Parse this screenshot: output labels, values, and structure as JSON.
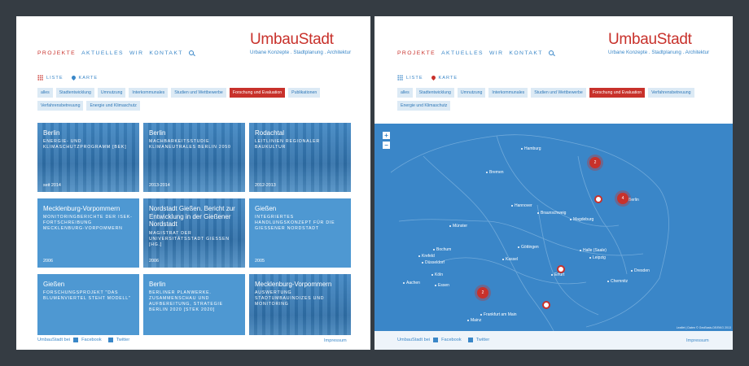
{
  "brand": {
    "logo": "UmbauStadt",
    "tagline": "Urbane Konzepte . Stadtplanung . Architektur",
    "accent": "#c8312b",
    "blue": "#3a87c8"
  },
  "nav": {
    "items": [
      "PROJEKTE",
      "AKTUELLES",
      "WIR",
      "KONTAKT"
    ]
  },
  "views": {
    "list": "LISTE",
    "map": "KARTE"
  },
  "filters": [
    "alles",
    "Stadtentwicklung",
    "Umnutzung",
    "Interkommunales",
    "Studien und Wettbewerbe",
    "Forschung und Evaluation",
    "Publikationen",
    "Verfahrensbetreuung",
    "Energie und Klimaschutz"
  ],
  "tiles": [
    {
      "title": "Berlin",
      "desc": "ENERGIE- UND KLIMASCHUTZPROGRAMM [BEK]",
      "year": "seit 2014"
    },
    {
      "title": "Berlin",
      "desc": "MACHBARKEITSSTUDIE KLIMANEUTRALES BERLIN 2050",
      "year": "2013-2014"
    },
    {
      "title": "Rodachtal",
      "desc": "LEITLINIEN REGIONALER BAUKULTUR",
      "year": "2012-2013"
    },
    {
      "title": "Mecklenburg-Vorpommern",
      "desc": "MONITORINGBERICHTE DER ISEK-FORTSCHREIBUNG MECKLENBURG-VORPOMMERN",
      "year": "2006"
    },
    {
      "title": "Nordstadt Gießen. Bericht zur Entwicklung in der Gießener Nordstadt",
      "desc": "MAGISTRAT DER UNIVERSITÄTSSTADT GIESSEN [HG.]",
      "year": "2006"
    },
    {
      "title": "Gießen",
      "desc": "INTEGRIERTES HANDLUNGSKONZEPT FÜR DIE GIESSENER NORDSTADT",
      "year": "2005"
    },
    {
      "title": "Gießen",
      "desc": "FORSCHUNGSPROJEKT \"DAS BLUMENVIERTEL STEHT MODELL\"",
      "year": ""
    },
    {
      "title": "Berlin",
      "desc": "BERLINER PLANWERKE. ZUSAMMENSCHAU UND AUFBEREITUNG, STRATEGIE BERLIN 2020 [STEK 2020]",
      "year": ""
    },
    {
      "title": "Mecklenburg-Vorpommern",
      "desc": "AUSWERTUNG STADTUMBAUINDIZES UND MONITORING",
      "year": ""
    }
  ],
  "footer": {
    "prefix": "UmbauStadt bei",
    "facebook": "Facebook",
    "twitter": "Twitter",
    "impressum": "Impressum"
  },
  "map": {
    "zoom_in": "+",
    "zoom_out": "−",
    "attribution": "Leaflet | Daten © GeoBasis-DE/BKG 2013",
    "cities": [
      "Hamburg",
      "Bremen",
      "Hannover",
      "Braunschweig",
      "Magdeburg",
      "Berlin",
      "Münster",
      "Bochum",
      "Krefeld",
      "Düsseldorf",
      "Köln",
      "Aachen",
      "Essen",
      "Göttingen",
      "Kassel",
      "Halle (Saale)",
      "Leipzig",
      "Dresden",
      "Chemnitz",
      "Erfurt",
      "Frankfurt am Main",
      "Mainz"
    ],
    "clusters": [
      "2",
      "4",
      "2"
    ]
  }
}
